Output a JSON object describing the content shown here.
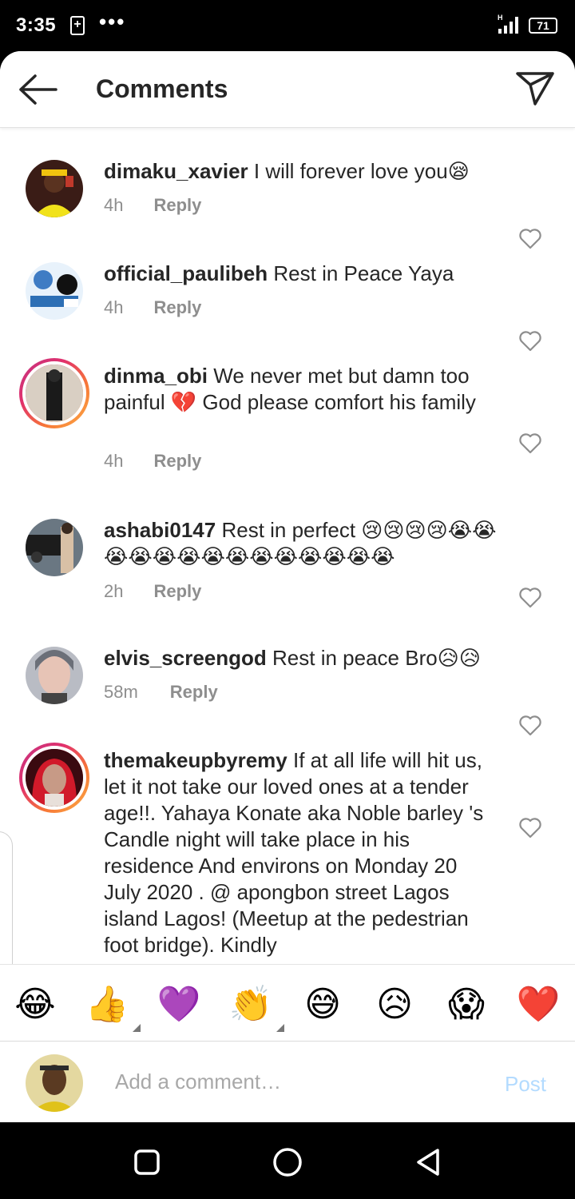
{
  "status_bar": {
    "time": "3:35",
    "battery": "71"
  },
  "header": {
    "title": "Comments"
  },
  "comments": [
    {
      "user": "dimaku_xavier",
      "text": "I will forever love you😪",
      "time": "4h",
      "reply": "Reply"
    },
    {
      "user": "official_paulibeh",
      "text": "Rest in Peace Yaya",
      "time": "4h",
      "reply": "Reply"
    },
    {
      "user": "dinma_obi",
      "text": "We never met but damn too painful 💔 God please comfort his family",
      "time": "4h",
      "reply": "Reply"
    },
    {
      "user": "ashabi0147",
      "text": "Rest in perfect 😢😢😢😢😭😭😭😭😭😭😭😭😭😭😭😭😭😭",
      "time": "2h",
      "reply": "Reply"
    },
    {
      "user": "elvis_screengod",
      "text": "Rest in peace Bro😥😥",
      "time": "58m",
      "reply": "Reply"
    },
    {
      "user": "themakeupbyremy",
      "text": "If at all life will hit us, let it not take our loved ones at a tender age!!. Yahaya Konate aka Noble barley 's Candle night will take place in his residence And environs on Monday 20 July 2020 . @ apongbon street Lagos island Lagos! (Meetup at the pedestrian foot bridge). Kindly"
    }
  ],
  "emoji_bar": [
    "😂",
    "👍",
    "💜",
    "👏",
    "😅",
    "😥",
    "😱",
    "❤️"
  ],
  "composer": {
    "placeholder": "Add a comment…",
    "post_label": "Post"
  },
  "colors": {
    "text": "#262626",
    "secondary": "#8e8e8e",
    "post_disabled": "#b3dbff"
  }
}
